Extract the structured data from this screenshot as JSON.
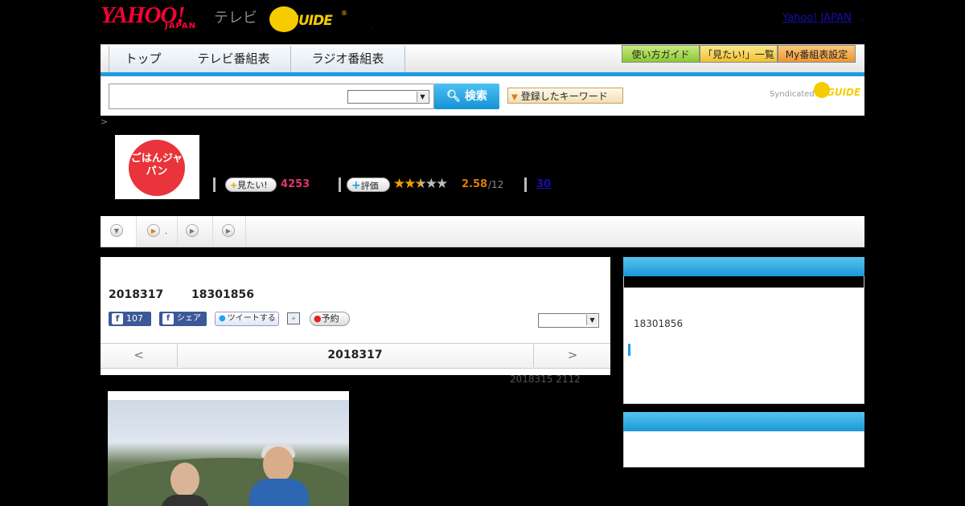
{
  "header": {
    "logo_yahoo": "YAHOO!",
    "logo_japan": "JAPAN",
    "logo_tv": "テレビ",
    "logo_guide": "GUIDE",
    "logo_reg": "®",
    "dot": ".",
    "yahoo_japan_link": "Yahoo! JAPAN",
    "yahoo_link_dot": "."
  },
  "nav": {
    "tabs": [
      {
        "label": "トップ"
      },
      {
        "label": "テレビ番組表"
      },
      {
        "label": "ラジオ番組表"
      }
    ],
    "buttons": [
      {
        "label": "使い方ガイド",
        "color": "#9bd23c"
      },
      {
        "label": "「見たい!」一覧",
        "color": "#f5cc3c"
      },
      {
        "label": "My番組表設定",
        "color": "#f0a23c"
      }
    ],
    "accent": "#1e9be0"
  },
  "search": {
    "placeholder": "",
    "button_label": "検索",
    "keyword_button": "登録したキーワード",
    "syndicated": "Syndicated"
  },
  "program": {
    "breadcrumb": ">",
    "thumbnail_text": "ごはんジャパン",
    "mitai_label": "見たい!",
    "mitai_count": "4253",
    "rating_label": "評価",
    "rating_value": 2.58,
    "rating_score": "2.58",
    "rating_votes": "/12",
    "comments_count": "30"
  },
  "tabs": {
    "dot": "."
  },
  "main": {
    "date": "2018317",
    "time": "18301856",
    "fb_like_count": "107",
    "fb_share": "シェア",
    "tweet": "ツイートする",
    "reserve": "予約",
    "day_prev": "<",
    "day_date": "2018317",
    "day_next": ">",
    "updated": "2018315  2112"
  },
  "sidebar": {
    "time": "18301856"
  }
}
